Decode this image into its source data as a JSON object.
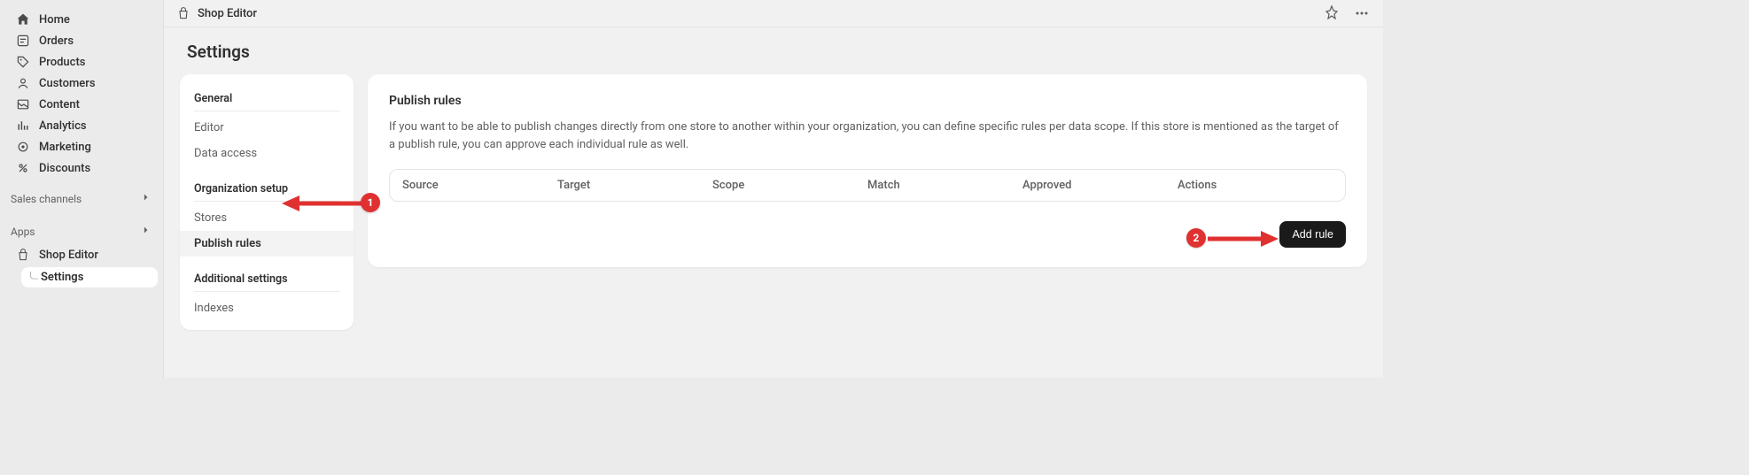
{
  "sidebar": {
    "items": [
      {
        "label": "Home",
        "icon": "home-icon"
      },
      {
        "label": "Orders",
        "icon": "orders-icon"
      },
      {
        "label": "Products",
        "icon": "products-icon"
      },
      {
        "label": "Customers",
        "icon": "customers-icon"
      },
      {
        "label": "Content",
        "icon": "content-icon"
      },
      {
        "label": "Analytics",
        "icon": "analytics-icon"
      },
      {
        "label": "Marketing",
        "icon": "marketing-icon"
      },
      {
        "label": "Discounts",
        "icon": "discounts-icon"
      }
    ],
    "sections": {
      "sales_channels": "Sales channels",
      "apps": "Apps"
    },
    "app_items": [
      {
        "label": "Shop Editor"
      },
      {
        "label": "Settings",
        "active": true
      }
    ]
  },
  "topbar": {
    "title": "Shop Editor"
  },
  "page": {
    "title": "Settings"
  },
  "side_menu": {
    "groups": [
      {
        "title": "General",
        "items": [
          {
            "label": "Editor"
          },
          {
            "label": "Data access"
          }
        ]
      },
      {
        "title": "Organization setup",
        "items": [
          {
            "label": "Stores"
          },
          {
            "label": "Publish rules",
            "active": true
          }
        ]
      },
      {
        "title": "Additional settings",
        "items": [
          {
            "label": "Indexes"
          }
        ]
      }
    ]
  },
  "main": {
    "title": "Publish rules",
    "description": "If you want to be able to publish changes directly from one store to another within your organization, you can define specific rules per data scope. If this store is mentioned as the target of a publish rule, you can approve each individual rule as well.",
    "columns": [
      "Source",
      "Target",
      "Scope",
      "Match",
      "Approved",
      "Actions"
    ],
    "add_button": "Add rule"
  },
  "annotations": {
    "badge1": "1",
    "badge2": "2"
  }
}
